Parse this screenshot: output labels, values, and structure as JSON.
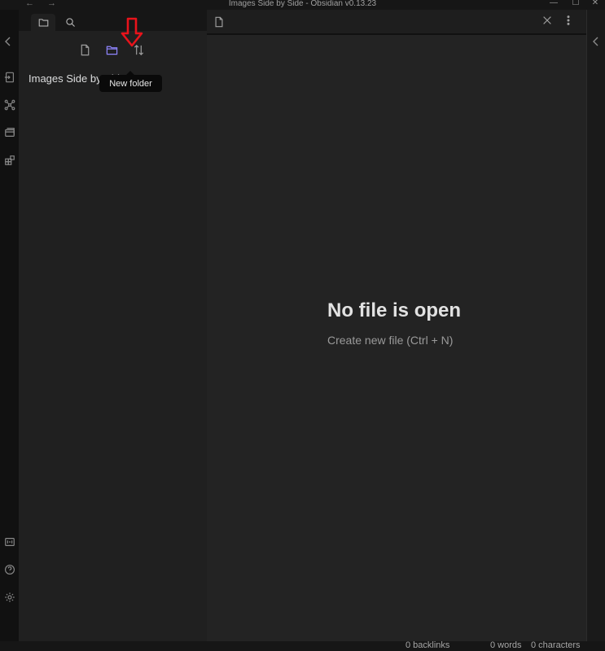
{
  "window": {
    "title": "Images Side by Side - Obsidian v0.13.23",
    "back": "←",
    "forward": "→",
    "minimize": "—",
    "maximize": "☐",
    "close": "✕"
  },
  "ribbon": {
    "top_icons": [
      "open-quick-switcher-icon",
      "graph-view-icon",
      "open-daily-note-icon",
      "open-slides-icon"
    ],
    "bottom_icons": [
      "open-another-vault-icon",
      "help-icon",
      "settings-icon"
    ]
  },
  "left_panel": {
    "tabs": [
      "file-explorer-icon",
      "search-icon"
    ],
    "actions": [
      "new-note-icon",
      "new-folder-icon",
      "sort-icon"
    ],
    "tooltip": "New folder",
    "vault_name": "Images Side by Side"
  },
  "main": {
    "empty_title": "No file is open",
    "empty_action": "Create new file (Ctrl + N)"
  },
  "status": {
    "backlinks": "0 backlinks",
    "words": "0 words",
    "characters": "0 characters"
  },
  "colors": {
    "accent": "#8f85ff",
    "annotation_arrow": "#e8131b",
    "background": "#1e1e1e"
  }
}
